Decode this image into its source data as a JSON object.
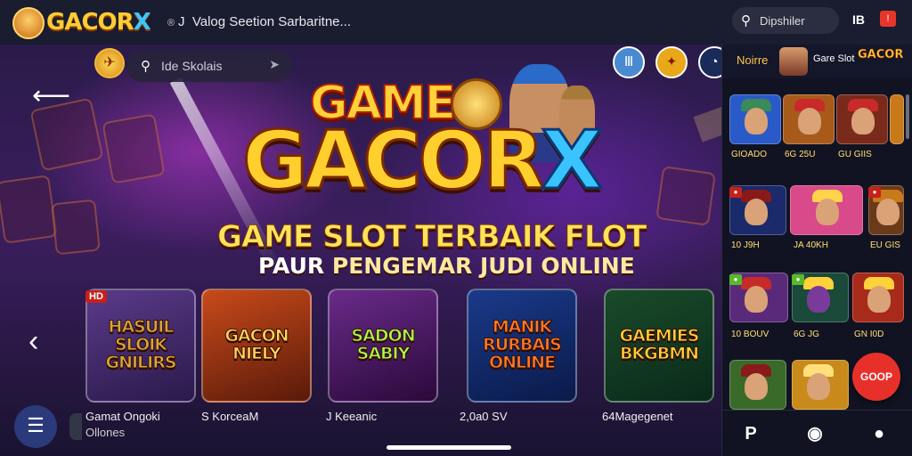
{
  "topbar": {
    "logo_text": "GACOR",
    "logo_x": "X",
    "logo_tm": "®",
    "title": "Valog Seetion Sarbaritne...",
    "title_prefix": "J",
    "search_label": "Dipshiler",
    "icon1": "IB",
    "icon2": "!"
  },
  "hero": {
    "search_label": "Ide Skolais",
    "coin_icon": "✈",
    "circle_icons": [
      "Ⅲ",
      "✦",
      "◔"
    ],
    "title_game": "GAME",
    "title_gacor": "GACOR",
    "title_x": "X",
    "subtitle1": "GAME SLOT TERBAIK FLOT",
    "subtitle2_a": "PAUR",
    "subtitle2_b": "PENGEMAR JUDI ONLINE",
    "back_arrow": "⟵",
    "left_chevron": "‹",
    "menu_icon": "☰"
  },
  "cards": [
    {
      "text": "HASUIL SLOIK GNILIRS",
      "caption": "Gamat Ongoki",
      "sub": "Ollones",
      "badge": "HD",
      "colors": [
        "#5a3a8a",
        "#d7a83a"
      ]
    },
    {
      "text": "GACON NIELY",
      "caption": "S KorceaM",
      "colors": [
        "#c84a1a",
        "#ffd45a"
      ]
    },
    {
      "text": "SADON SABIY",
      "caption": "J Keeanic",
      "colors": [
        "#6a2a8a",
        "#a8ff4a"
      ]
    },
    {
      "text": "MANIK RURBAIS ONLINE",
      "caption": "2,0a0 SV",
      "colors": [
        "#1a3a8a",
        "#ff7a2a"
      ]
    },
    {
      "text": "GAEMIES BKGBMN",
      "caption": "64Magegenet",
      "colors": [
        "#1a4a2a",
        "#ffd13a"
      ]
    }
  ],
  "rpanel": {
    "nav_label": "Noirre",
    "game_slot": "Gare Slot",
    "game_logo": "GACOR",
    "tiles": [
      {
        "caption": "GIOADO"
      },
      {
        "caption": "6G 25U"
      },
      {
        "caption": "GU GIIS"
      },
      {
        "caption": ""
      },
      {
        "caption": "10 J9H"
      },
      {
        "caption": "JA 40KH"
      },
      {
        "caption": "EU GIS"
      },
      {
        "caption": "10 BOUV"
      },
      {
        "caption": "6G JG"
      },
      {
        "caption": "GN I0D"
      }
    ],
    "fab_label": "GOOP",
    "nav_icons": [
      "P",
      "◉",
      "●"
    ]
  },
  "accent_colors": {
    "gold": "#ffcf2e",
    "blue": "#3ac4ff",
    "red": "#e8302a"
  }
}
